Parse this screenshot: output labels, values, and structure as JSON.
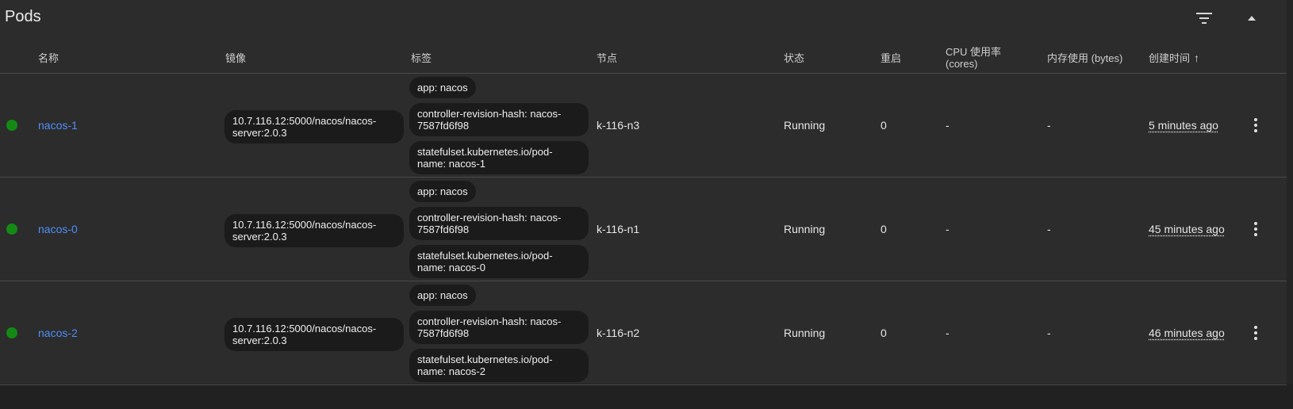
{
  "header": {
    "title": "Pods",
    "filter_icon": "filter-list-icon",
    "collapse_icon": "arrow-up-icon"
  },
  "columns": {
    "name": "名称",
    "image": "镜像",
    "labels": "标签",
    "node": "节点",
    "status": "状态",
    "restarts": "重启",
    "cpu": "CPU 使用率\n(cores)",
    "memory": "内存使用 (bytes)",
    "created": "创建时间",
    "created_sort_icon": "arrow-upward-icon"
  },
  "colors": {
    "running": "#138a13",
    "link": "#4f8ef7"
  },
  "rows": [
    {
      "name": "nacos-1",
      "image": "10.7.116.12:5000/nacos/nacos-server:2.0.3",
      "labels": [
        "app: nacos",
        "controller-revision-hash: nacos-7587fd6f98",
        "statefulset.kubernetes.io/pod-name: nacos-1"
      ],
      "node": "k-116-n3",
      "status": "Running",
      "restarts": "0",
      "cpu": "-",
      "memory": "-",
      "created": "5 minutes ago"
    },
    {
      "name": "nacos-0",
      "image": "10.7.116.12:5000/nacos/nacos-server:2.0.3",
      "labels": [
        "app: nacos",
        "controller-revision-hash: nacos-7587fd6f98",
        "statefulset.kubernetes.io/pod-name: nacos-0"
      ],
      "node": "k-116-n1",
      "status": "Running",
      "restarts": "0",
      "cpu": "-",
      "memory": "-",
      "created": "45 minutes ago"
    },
    {
      "name": "nacos-2",
      "image": "10.7.116.12:5000/nacos/nacos-server:2.0.3",
      "labels": [
        "app: nacos",
        "controller-revision-hash: nacos-7587fd6f98",
        "statefulset.kubernetes.io/pod-name: nacos-2"
      ],
      "node": "k-116-n2",
      "status": "Running",
      "restarts": "0",
      "cpu": "-",
      "memory": "-",
      "created": "46 minutes ago"
    }
  ]
}
